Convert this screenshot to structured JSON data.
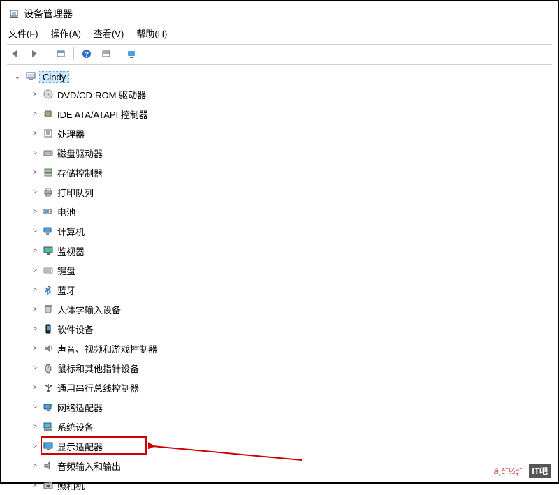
{
  "window": {
    "title": "设备管理器"
  },
  "menubar": {
    "file": "文件(F)",
    "action": "操作(A)",
    "view": "查看(V)",
    "help": "帮助(H)"
  },
  "toolbar_icons": {
    "back": "back-icon",
    "forward": "forward-icon",
    "show": "show-icon",
    "help": "help-icon",
    "view": "view-icon",
    "monitor": "monitor-icon"
  },
  "tree": {
    "root": "Cindy",
    "items": [
      {
        "label": "DVD/CD-ROM 驱动器",
        "icon": "disc"
      },
      {
        "label": "IDE ATA/ATAPI 控制器",
        "icon": "chip"
      },
      {
        "label": "处理器",
        "icon": "chip2"
      },
      {
        "label": "磁盘驱动器",
        "icon": "disk"
      },
      {
        "label": "存储控制器",
        "icon": "storage"
      },
      {
        "label": "打印队列",
        "icon": "printer"
      },
      {
        "label": "电池",
        "icon": "battery"
      },
      {
        "label": "计算机",
        "icon": "pc"
      },
      {
        "label": "监视器",
        "icon": "monitor"
      },
      {
        "label": "键盘",
        "icon": "keyboard"
      },
      {
        "label": "蓝牙",
        "icon": "bluetooth"
      },
      {
        "label": "人体学输入设备",
        "icon": "hid"
      },
      {
        "label": "软件设备",
        "icon": "soft"
      },
      {
        "label": "声音、视频和游戏控制器",
        "icon": "audio"
      },
      {
        "label": "鼠标和其他指针设备",
        "icon": "mouse"
      },
      {
        "label": "通用串行总线控制器",
        "icon": "usb"
      },
      {
        "label": "网络适配器",
        "icon": "net"
      },
      {
        "label": "系统设备",
        "icon": "system"
      },
      {
        "label": "显示适配器",
        "icon": "display",
        "highlight": true
      },
      {
        "label": "音频输入和输出",
        "icon": "audioio"
      },
      {
        "label": "照相机",
        "icon": "camera"
      }
    ]
  },
  "watermark": {
    "text": "ä¸č˝½ç˝",
    "box": "IT吧"
  }
}
